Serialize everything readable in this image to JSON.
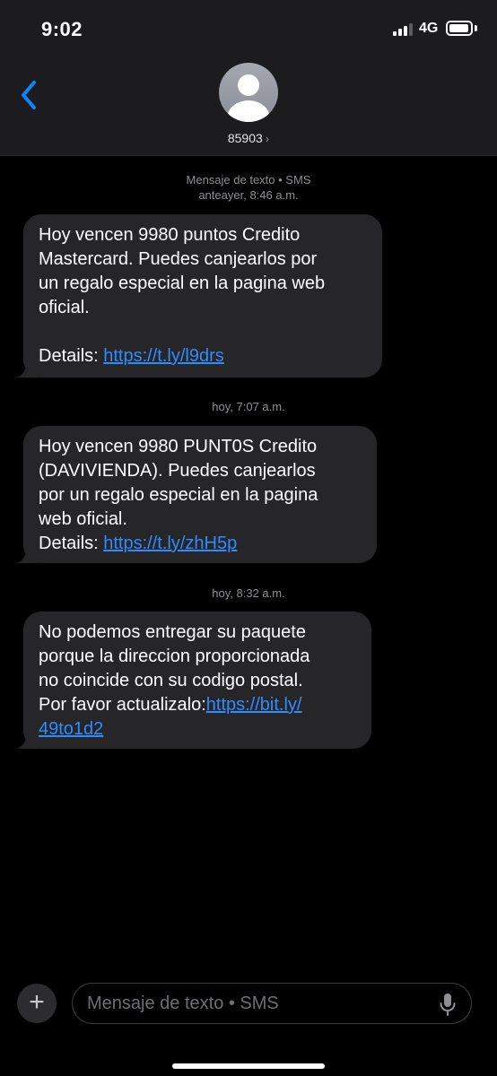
{
  "status_bar": {
    "time": "9:02",
    "network": "4G",
    "signal_bars_active": 3,
    "signal_bars_total": 4
  },
  "header": {
    "contact": "85903",
    "chevron": "›",
    "back_icon": "chevron-left-icon",
    "avatar_icon": "person-icon"
  },
  "colors": {
    "background": "#000000",
    "bubble": "#262628",
    "link": "#2e8cff",
    "accent": "#0a84ff"
  },
  "conversation": {
    "service_label": "Mensaje de texto • SMS",
    "messages": [
      {
        "timestamp_day": "anteayer,",
        "timestamp_time": "8:46 a.m.",
        "text": "Hoy vencen 9980 puntos Credito\nMastercard. Puedes canjearlos por\nun regalo especial en la pagina web\noficial.\n\nDetails: ",
        "link": "https://t.ly/l9drs"
      },
      {
        "timestamp_day": "hoy,",
        "timestamp_time": "7:07 a.m.",
        "text": "Hoy vencen 9980 PUNT0S Credito\n(DAVIVIENDA). Puedes canjearlos\npor un regalo especial en la pagina\nweb oficial.\nDetails: ",
        "link": "https://t.ly/zhH5p"
      },
      {
        "timestamp_day": "hoy,",
        "timestamp_time": "8:32 a.m.",
        "text": "No podemos entregar su paquete\nporque la direccion proporcionada\nno coincide con su codigo postal.\nPor favor actualizalo:",
        "link": "https://bit.ly/\n49to1d2"
      }
    ]
  },
  "composer": {
    "plus_label": "+",
    "placeholder": "Mensaje de texto • SMS",
    "mic_icon": "microphone-icon"
  }
}
